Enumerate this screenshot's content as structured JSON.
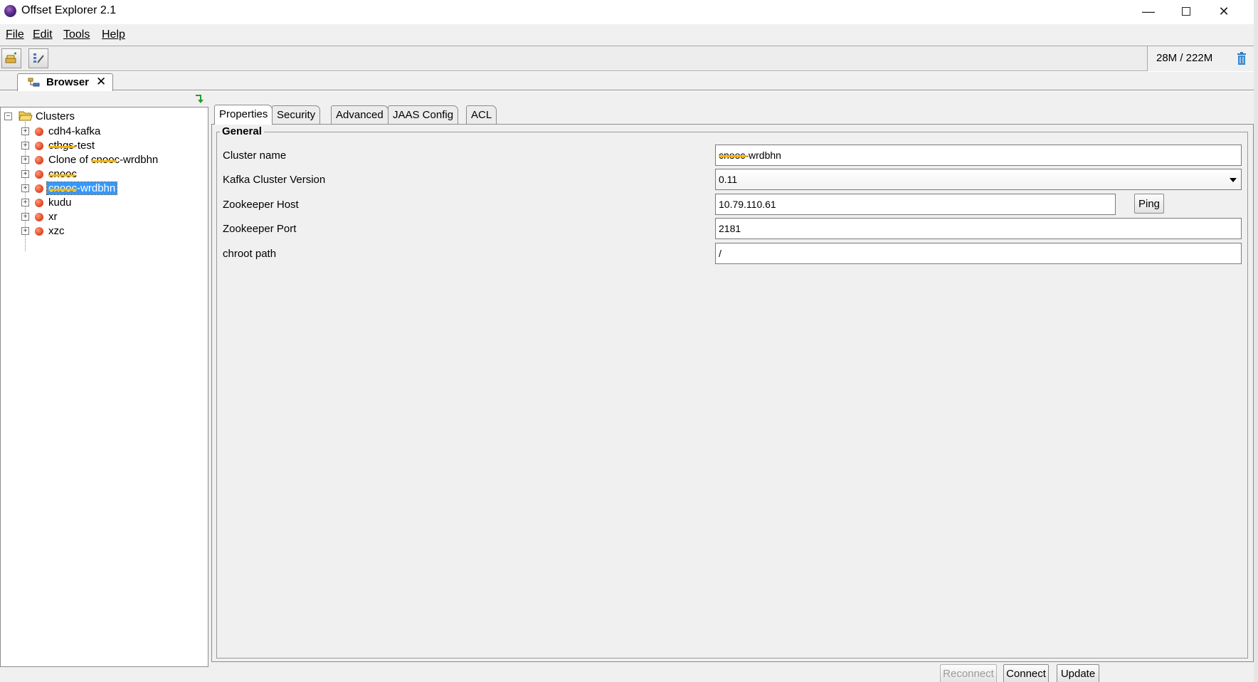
{
  "window": {
    "title": "Offset Explorer  2.1"
  },
  "menu": {
    "file": "File",
    "edit": "Edit",
    "tools": "Tools",
    "help": "Help"
  },
  "toolbar": {
    "memory": "28M / 222M"
  },
  "browser_tab": {
    "label": "Browser",
    "close": "✕"
  },
  "tree": {
    "root": "Clusters",
    "items": [
      {
        "label": "cdh4-kafka",
        "selected": false
      },
      {
        "label": "cthgs-test",
        "selected": false
      },
      {
        "label": "Clone of cnooc-wrdbhn",
        "selected": false
      },
      {
        "label": "cnooc",
        "selected": false
      },
      {
        "label": "cnooc-wrdbhn",
        "selected": true
      },
      {
        "label": "kudu",
        "selected": false
      },
      {
        "label": "xr",
        "selected": false
      },
      {
        "label": "xzc",
        "selected": false
      }
    ]
  },
  "tabs": [
    "Properties",
    "Security",
    "Advanced",
    "JAAS Config",
    "ACL"
  ],
  "general": {
    "title": "General",
    "cluster_name_label": "Cluster name",
    "cluster_name_value": "cnooc-wrdbhn",
    "version_label": "Kafka Cluster Version",
    "version_value": "0.11",
    "zk_host_label": "Zookeeper Host",
    "zk_host_value": "10.79.110.61",
    "ping": "Ping",
    "zk_port_label": "Zookeeper Port",
    "zk_port_value": "2181",
    "chroot_label": "chroot path",
    "chroot_value": "/"
  },
  "actions": {
    "reconnect": "Reconnect",
    "connect": "Connect",
    "update": "Update"
  },
  "colors": {
    "selection": "#3399ff",
    "cluster_dot": "#e8512e",
    "redaction": "#f4b400"
  }
}
